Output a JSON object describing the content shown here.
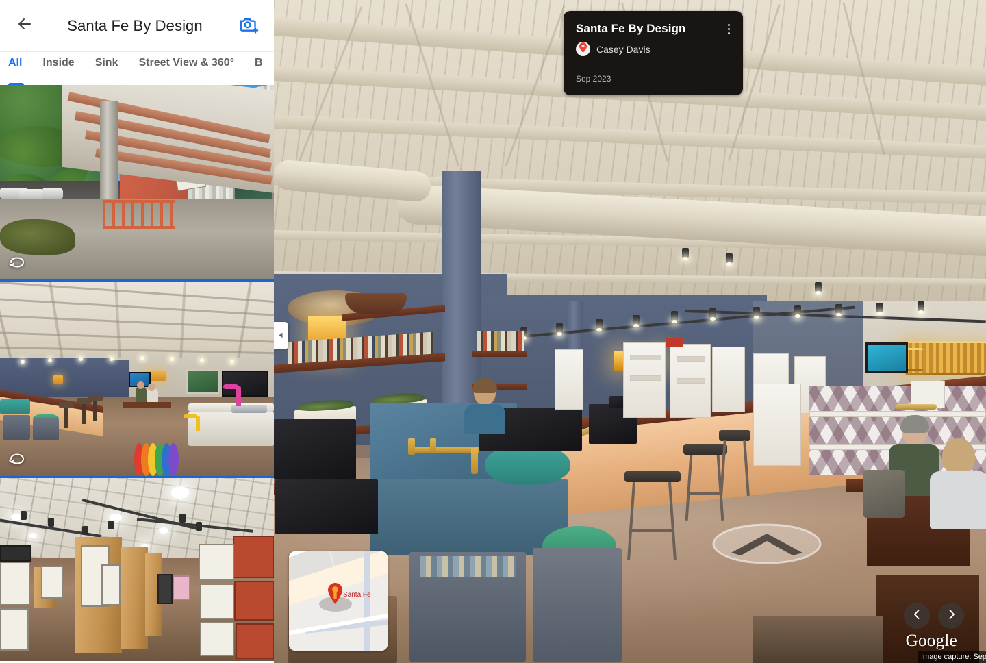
{
  "app": {
    "header": {
      "title": "Santa Fe By Design",
      "back_icon": "arrow-left-icon",
      "add_photo_icon": "add-photo-camera-icon"
    },
    "tabs": [
      {
        "label": "All",
        "active": true
      },
      {
        "label": "Inside",
        "active": false
      },
      {
        "label": "Sink",
        "active": false
      },
      {
        "label": "Street View & 360°",
        "active": false
      },
      {
        "label": "B",
        "active": false
      }
    ],
    "thumbnails": [
      {
        "name": "exterior-entrance-photo",
        "badge_icon": "pano-360-icon",
        "alt": "Exterior walkway with terracotta stucco wall, metal canopy, trees and parking lot"
      },
      {
        "name": "showroom-interior-photo",
        "badge_icon": "pano-360-icon",
        "alt": "Kitchen and bath showroom interior with colorful sinks and bar counter"
      },
      {
        "name": "hardware-aisle-photo",
        "badge_icon": null,
        "alt": "Hardware display aisle with wooden panels and track lighting"
      }
    ]
  },
  "streetview": {
    "info_card": {
      "title": "Santa Fe By Design",
      "author": "Casey Davis",
      "date": "Sep 2023",
      "menu_icon": "more-vert-icon",
      "avatar_icon": "map-pin-icon"
    },
    "collapse_icon": "chevron-left-icon",
    "nav_chevron_icon": "move-forward-chevron-icon",
    "minimap": {
      "label": "Santa Fe",
      "pin_icon": "pegman-pin-icon"
    },
    "pano_nav": {
      "prev_icon": "chevron-left-icon",
      "prev_label": "Previous photo",
      "next_icon": "chevron-right-icon",
      "next_label": "Next photo"
    },
    "watermark": "Google",
    "capture_text": "Image capture: Sep",
    "scene_alt": "360 interior panorama of Santa Fe By Design showroom: exposed white ceiling joists and round duct, blue-gray column, blue concrete sink with gold wall faucet, teal vessel sink, long wood bar counter with stools, book shelves, and customers seated at a table"
  },
  "colors": {
    "accent_blue": "#1a73e8",
    "divider_blue": "#1967d2",
    "text_primary": "#202124",
    "text_secondary": "#5f6368",
    "card_bg": "#191512",
    "pin_red": "#c5221f"
  }
}
